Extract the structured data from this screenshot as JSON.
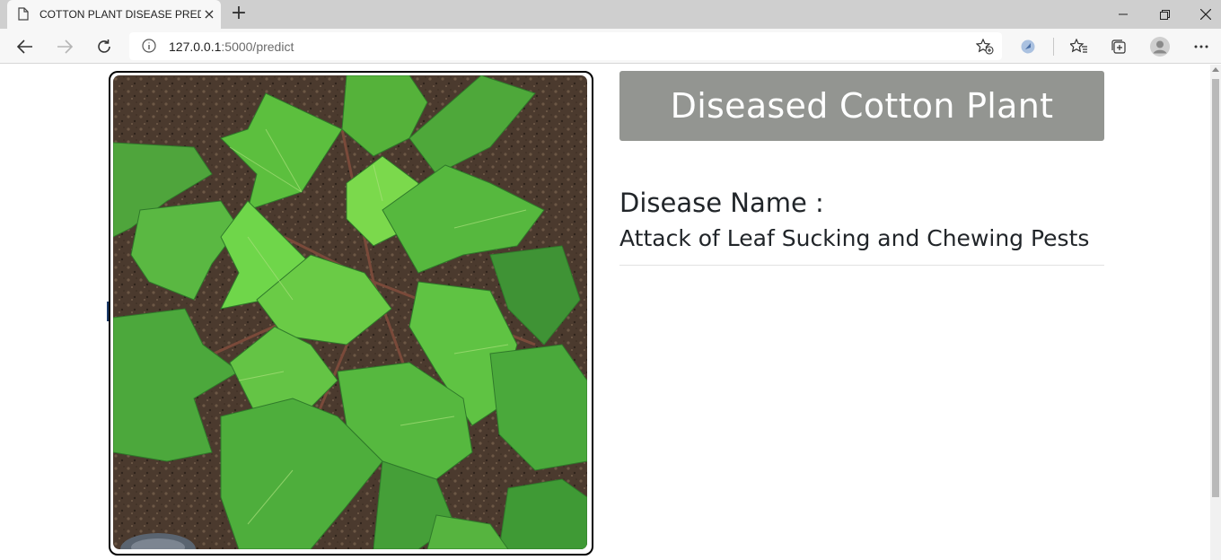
{
  "browser": {
    "tab_title": "COTTON PLANT DISEASE PREDICTION",
    "tab_close": "×",
    "new_tab": "+",
    "url_host": "127.0.0.1",
    "url_path": ":5000/predict",
    "colors": {
      "titlebar": "#cfcfcf",
      "toolbar": "#f7f7f7"
    }
  },
  "page": {
    "image": {
      "subject": "cotton-plant-leaves-photo"
    },
    "result_title": "Diseased Cotton Plant",
    "disease_label": "Disease Name :",
    "disease_name": "Attack of Leaf Sucking and Chewing Pests",
    "colors": {
      "header_bg": "#939591",
      "header_text": "#ffffff",
      "text": "#212529"
    }
  }
}
